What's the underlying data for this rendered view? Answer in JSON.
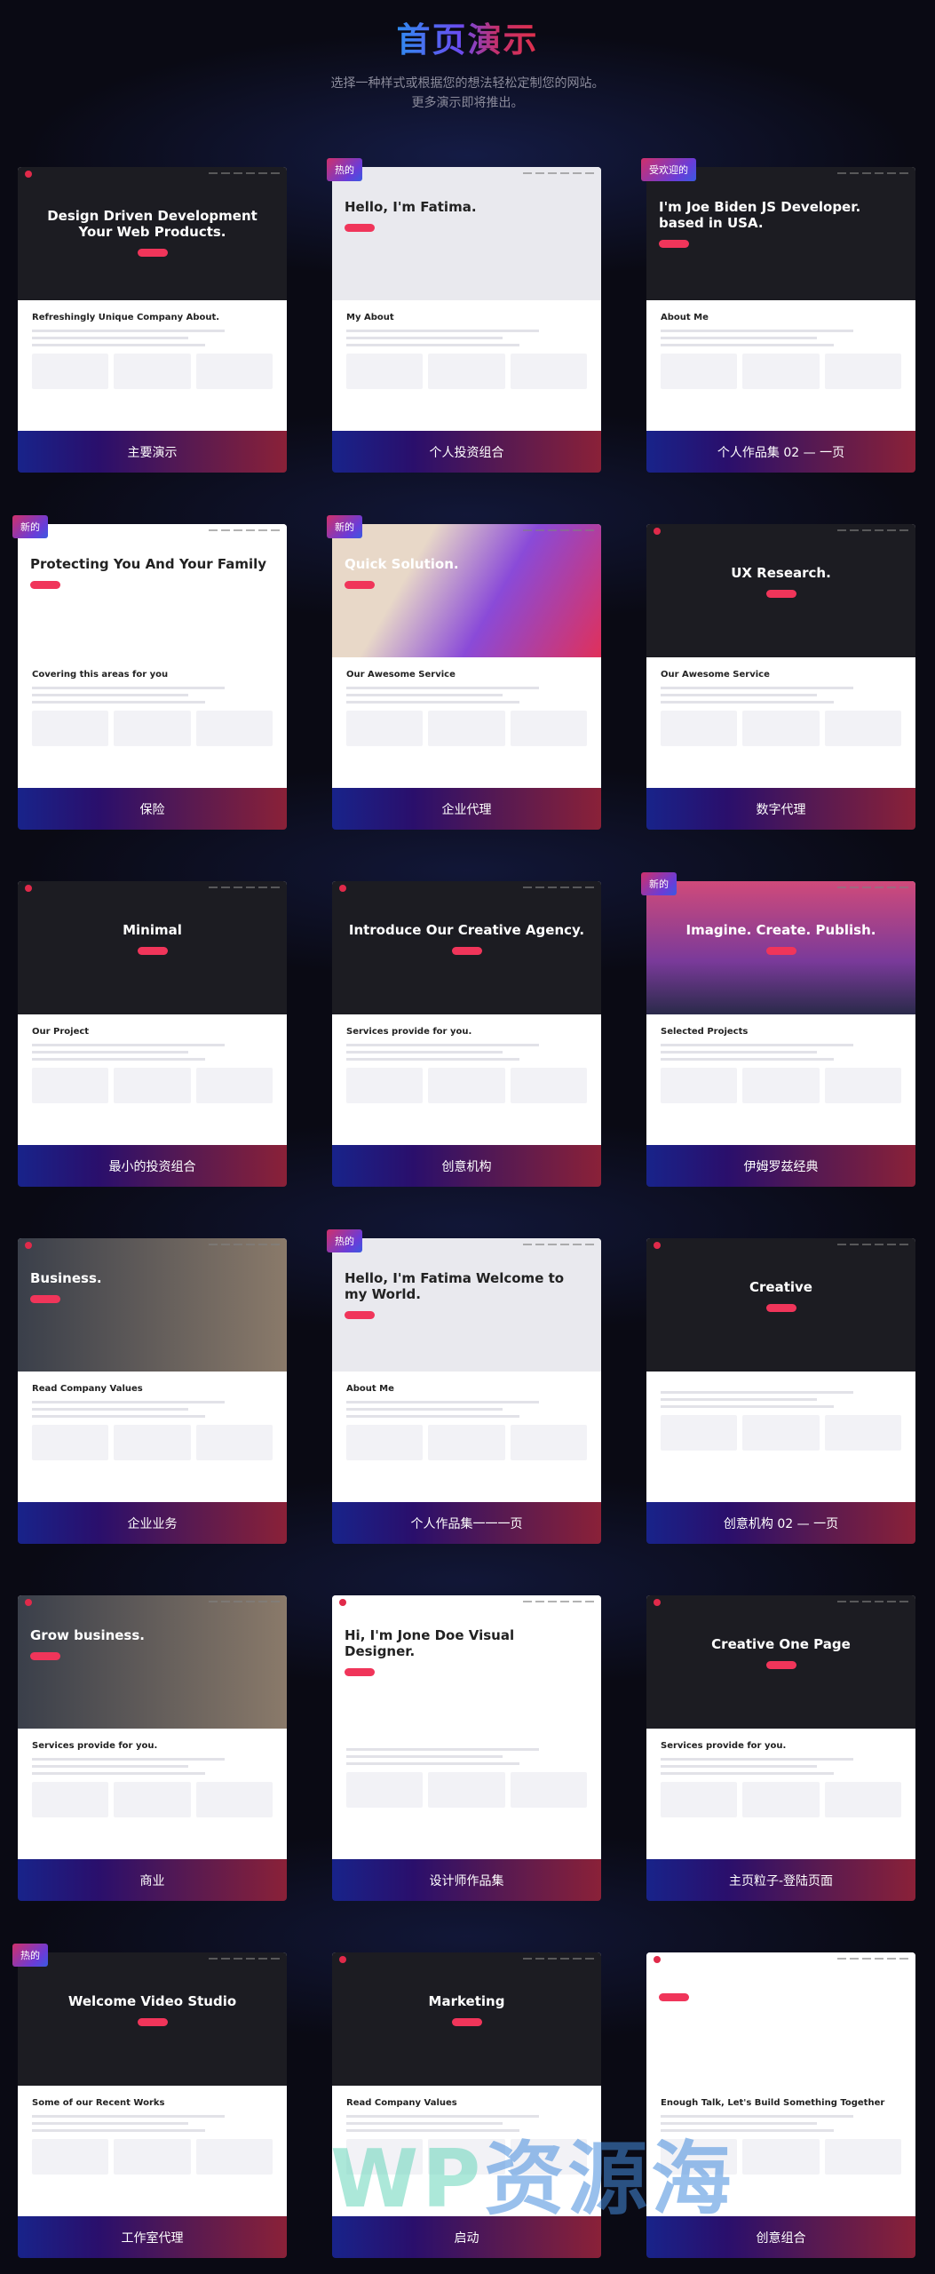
{
  "header": {
    "title": "首页演示",
    "subtitle_line1": "选择一种样式或根据您的想法轻松定制您的网站。",
    "subtitle_line2": "更多演示即将推出。"
  },
  "colors": {
    "accent": "#f0355a",
    "bar_left": "#18238a",
    "bar_right": "#8a2138",
    "background": "#0a0a14"
  },
  "demos": [
    {
      "label": "主要演示",
      "badge": "",
      "hero": "Design Driven Development Your Web Products.",
      "section": "Refreshingly Unique Company About.",
      "theme": "dark"
    },
    {
      "label": "个人投资组合",
      "badge": "热的",
      "hero": "Hello, I'm Fatima.",
      "section": "My About",
      "theme": "light"
    },
    {
      "label": "个人作品集 02 — 一页",
      "badge": "受欢迎的",
      "hero": "I'm Joe Biden JS Developer. based in USA.",
      "section": "About Me",
      "theme": "dark"
    },
    {
      "label": "保险",
      "badge": "新的",
      "hero": "Protecting You And Your Family",
      "section": "Covering this areas for you",
      "theme": "white"
    },
    {
      "label": "企业代理",
      "badge": "新的",
      "hero": "Quick Solution.",
      "section": "Our Awesome Service",
      "theme": "gradient"
    },
    {
      "label": "数字代理",
      "badge": "",
      "hero": "UX Research.",
      "section": "Our Awesome Service",
      "theme": "dark"
    },
    {
      "label": "最小的投资组合",
      "badge": "",
      "hero": "Minimal",
      "section": "Our Project",
      "theme": "dark"
    },
    {
      "label": "创意机构",
      "badge": "",
      "hero": "Introduce Our Creative Agency.",
      "section": "Services provide for you.",
      "theme": "dark"
    },
    {
      "label": "伊姆罗兹经典",
      "badge": "新的",
      "hero": "Imagine. Create. Publish.",
      "section": "Selected Projects",
      "theme": "sunset"
    },
    {
      "label": "企业业务",
      "badge": "",
      "hero": "Business.",
      "section": "Read Company Values",
      "theme": "photo"
    },
    {
      "label": "个人作品集一一一页",
      "badge": "热的",
      "hero": "Hello, I'm Fatima Welcome to my World.",
      "section": "About Me",
      "theme": "light"
    },
    {
      "label": "创意机构 02 — 一页",
      "badge": "",
      "hero": "Creative",
      "section": "",
      "theme": "dark"
    },
    {
      "label": "商业",
      "badge": "",
      "hero": "Grow business.",
      "section": "Services provide for you.",
      "theme": "photo"
    },
    {
      "label": "设计师作品集",
      "badge": "",
      "hero": "Hi, I'm Jone Doe Visual Designer.",
      "section": "",
      "theme": "white"
    },
    {
      "label": "主页粒子-登陆页面",
      "badge": "",
      "hero": "Creative One Page",
      "section": "Services provide for you.",
      "theme": "dark"
    },
    {
      "label": "工作室代理",
      "badge": "热的",
      "hero": "Welcome Video Studio",
      "section": "Some of our Recent Works",
      "theme": "dark"
    },
    {
      "label": "启动",
      "badge": "",
      "hero": "Marketing",
      "section": "Read Company Values",
      "theme": "dark"
    },
    {
      "label": "创意组合",
      "badge": "",
      "hero": "",
      "section": "Enough Talk, Let's Build Something Together",
      "theme": "white"
    }
  ],
  "watermark": "WP资源海"
}
